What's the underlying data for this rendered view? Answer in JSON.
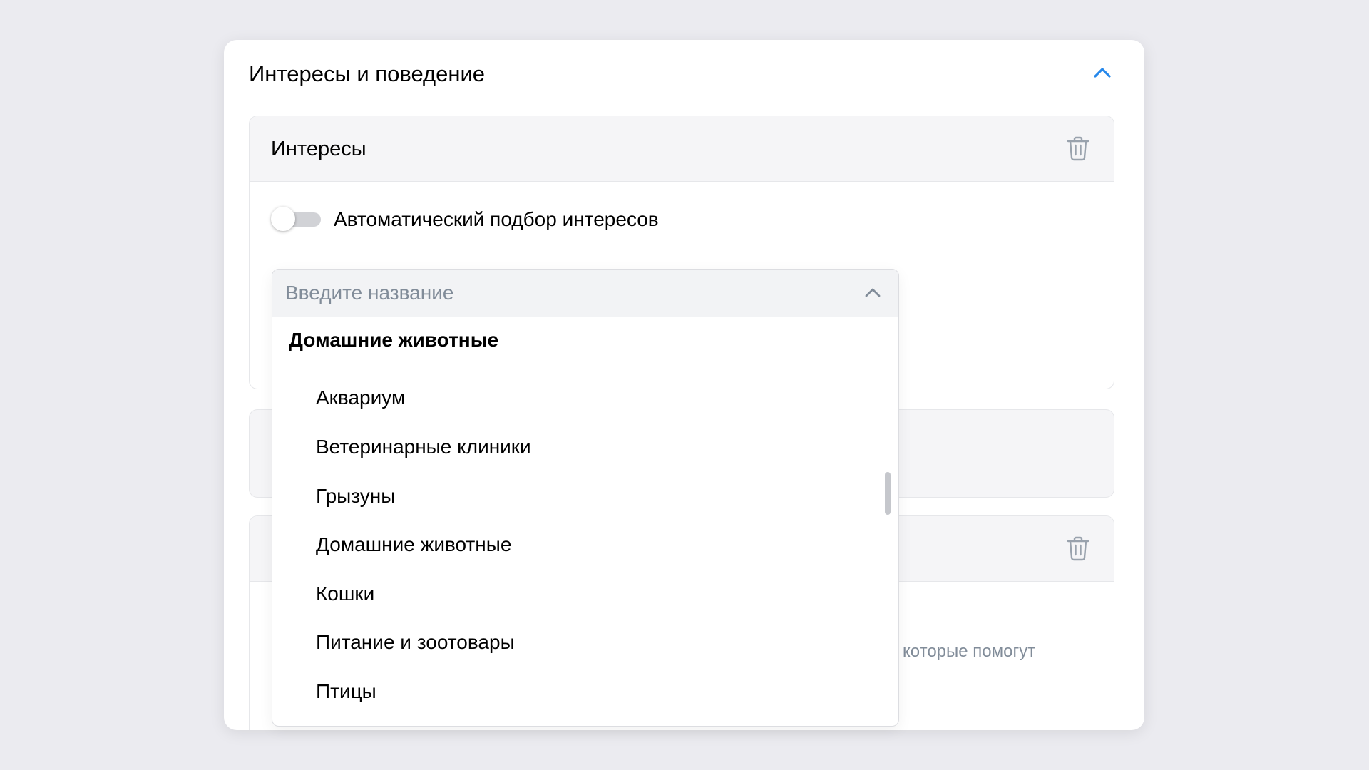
{
  "card": {
    "title": "Интересы и поведение"
  },
  "interests_section": {
    "title": "Интересы",
    "auto_toggle": {
      "label": "Автоматический подбор интересов",
      "on": false
    }
  },
  "third_section": {
    "partial_text": "которые помогут"
  },
  "dropdown": {
    "placeholder": "Введите название",
    "value": "",
    "group_label": "Домашние животные",
    "items": [
      "Аквариум",
      "Ветеринарные клиники",
      "Грызуны",
      "Домашние животные",
      "Кошки",
      "Питание и зоотовары",
      "Птицы"
    ]
  },
  "icons": {
    "collapse": "chevron-up-icon",
    "delete": "trash-icon"
  },
  "colors": {
    "accent": "#2688eb",
    "background": "#ebebf0",
    "muted_text": "#818c99",
    "icon_gray": "#99a2ad"
  }
}
